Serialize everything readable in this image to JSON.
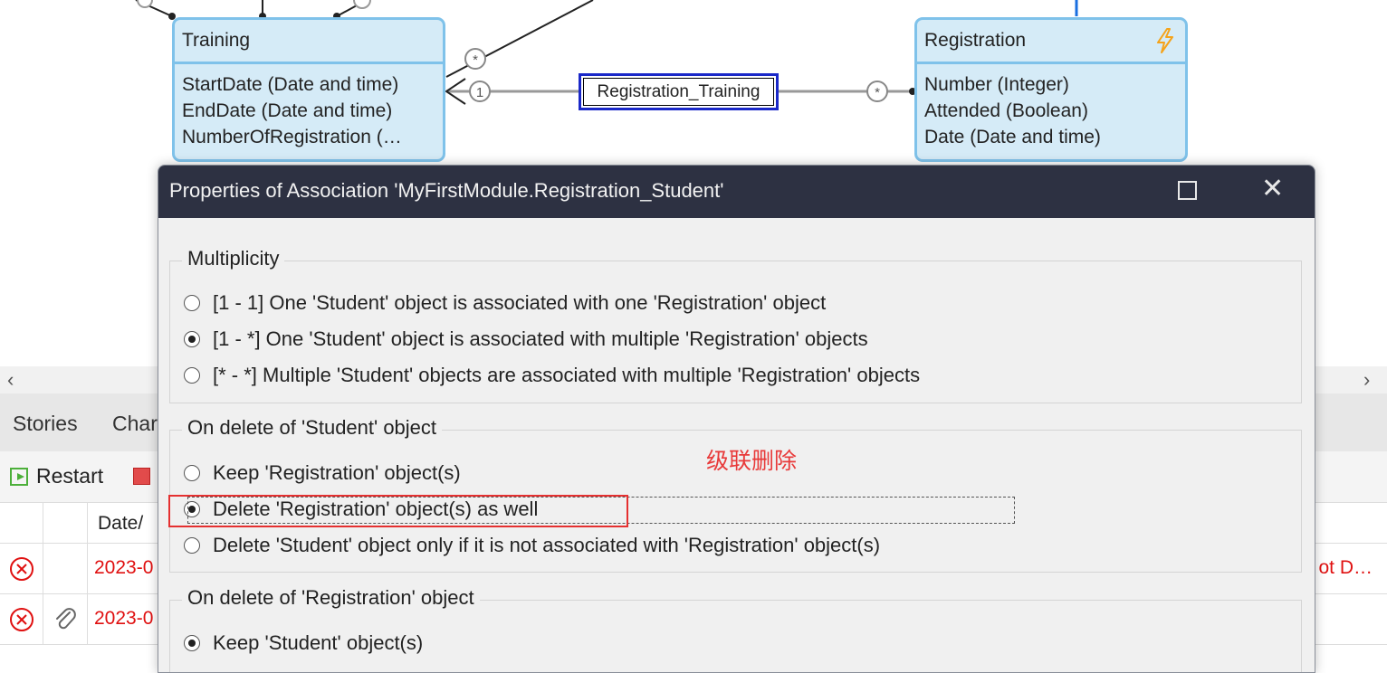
{
  "diagram": {
    "training": {
      "name": "Training",
      "attributes": [
        "StartDate (Date and time)",
        "EndDate (Date and time)",
        "NumberOfRegistration (…"
      ]
    },
    "registration": {
      "name": "Registration",
      "attributes": [
        "Number (Integer)",
        "Attended (Boolean)",
        "Date (Date and time)"
      ]
    },
    "association_label": "Registration_Training",
    "multiplicity_one": "1",
    "multiplicity_many": "*"
  },
  "bottom_panel": {
    "tabs": [
      "Stories",
      "Char"
    ],
    "restart_label": "Restart",
    "column_header": "Date/",
    "rows": [
      {
        "date": "2023-0",
        "right": "ot D…",
        "attachment": false
      },
      {
        "date": "2023-0",
        "right": "",
        "attachment": true
      }
    ]
  },
  "dialog": {
    "title": "Properties of Association 'MyFirstModule.Registration_Student'",
    "multiplicity": {
      "legend": "Multiplicity",
      "options": [
        "[1 - 1] One 'Student' object is associated with one 'Registration' object",
        "[1 - *] One 'Student' object is associated with multiple 'Registration' objects",
        "[* - *] Multiple 'Student' objects are associated with multiple 'Registration' objects"
      ],
      "selected": 1
    },
    "on_delete_student": {
      "legend": "On delete of 'Student' object",
      "options": [
        "Keep 'Registration' object(s)",
        "Delete 'Registration' object(s) as well",
        "Delete 'Student' object only if it is not associated with 'Registration' object(s)"
      ],
      "selected": 1
    },
    "on_delete_registration": {
      "legend": "On delete of 'Registration' object",
      "options": [
        "Keep 'Student' object(s)"
      ],
      "selected": 0
    }
  },
  "annotation": "级联删除",
  "colors": {
    "entity_fill": "#d5ebf7",
    "entity_border": "#7fc2ea",
    "dialog_titlebar": "#2d3142",
    "annotation_red": "#e53030",
    "error_red": "#e01010"
  }
}
